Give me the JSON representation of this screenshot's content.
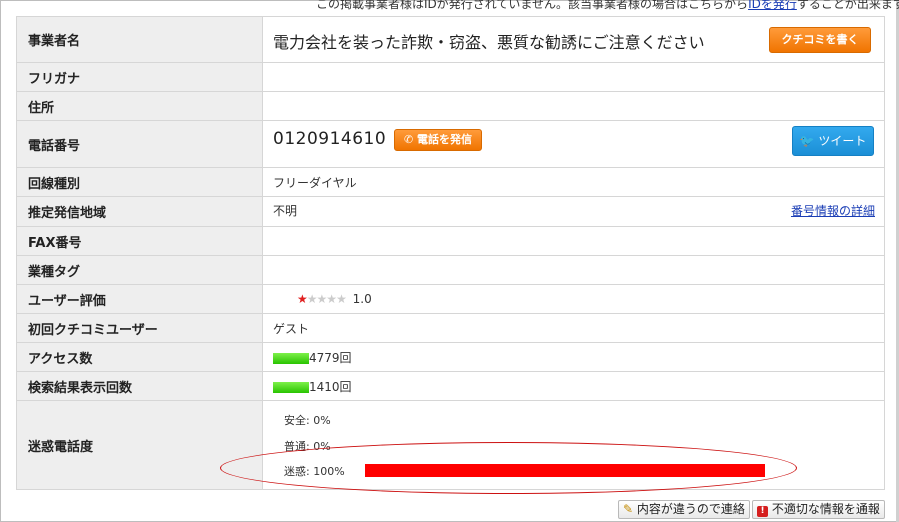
{
  "top_note": {
    "before": "この掲載事業者様はIDが発行されていません。該当事業者様の場合はこちらから",
    "link": "IDを発行",
    "after": "することが出来ます。"
  },
  "rows": {
    "business_name": {
      "label": "事業者名",
      "value": "電力会社を装った詐欺・窃盗、悪質な勧誘にご注意ください",
      "button": "クチコミを書く"
    },
    "furigana": {
      "label": "フリガナ",
      "value": ""
    },
    "address": {
      "label": "住所",
      "value": ""
    },
    "phone": {
      "label": "電話番号",
      "value": "0120914610",
      "call_button": "電話を発信",
      "tweet_button": "ツイート"
    },
    "line_type": {
      "label": "回線種別",
      "value": "フリーダイヤル"
    },
    "region": {
      "label": "推定発信地域",
      "value": "不明",
      "link": "番号情報の詳細"
    },
    "fax": {
      "label": "FAX番号",
      "value": ""
    },
    "industry_tag": {
      "label": "業種タグ",
      "value": ""
    },
    "rating": {
      "label": "ユーザー評価",
      "value": "1.0",
      "stars_filled": 1,
      "stars_total": 5
    },
    "first_user": {
      "label": "初回クチコミユーザー",
      "value": "ゲスト"
    },
    "access": {
      "label": "アクセス数",
      "value": "4779回"
    },
    "search_count": {
      "label": "検索結果表示回数",
      "value": "1410回"
    },
    "nuisance": {
      "label": "迷惑電話度",
      "levels": [
        {
          "text": "安全: 0%",
          "percent": 0
        },
        {
          "text": "普通: 0%",
          "percent": 0
        },
        {
          "text": "迷惑: 100%",
          "percent": 100
        }
      ]
    }
  },
  "footer": {
    "contact_button": "内容が違うので連絡",
    "report_button": "不適切な情報を通報"
  },
  "colors": {
    "accent_orange": "#f07400",
    "tweet_blue": "#1b8fd6",
    "danger_red": "#ff0000",
    "bar_green": "#29c400",
    "link_blue": "#1a3db5"
  }
}
